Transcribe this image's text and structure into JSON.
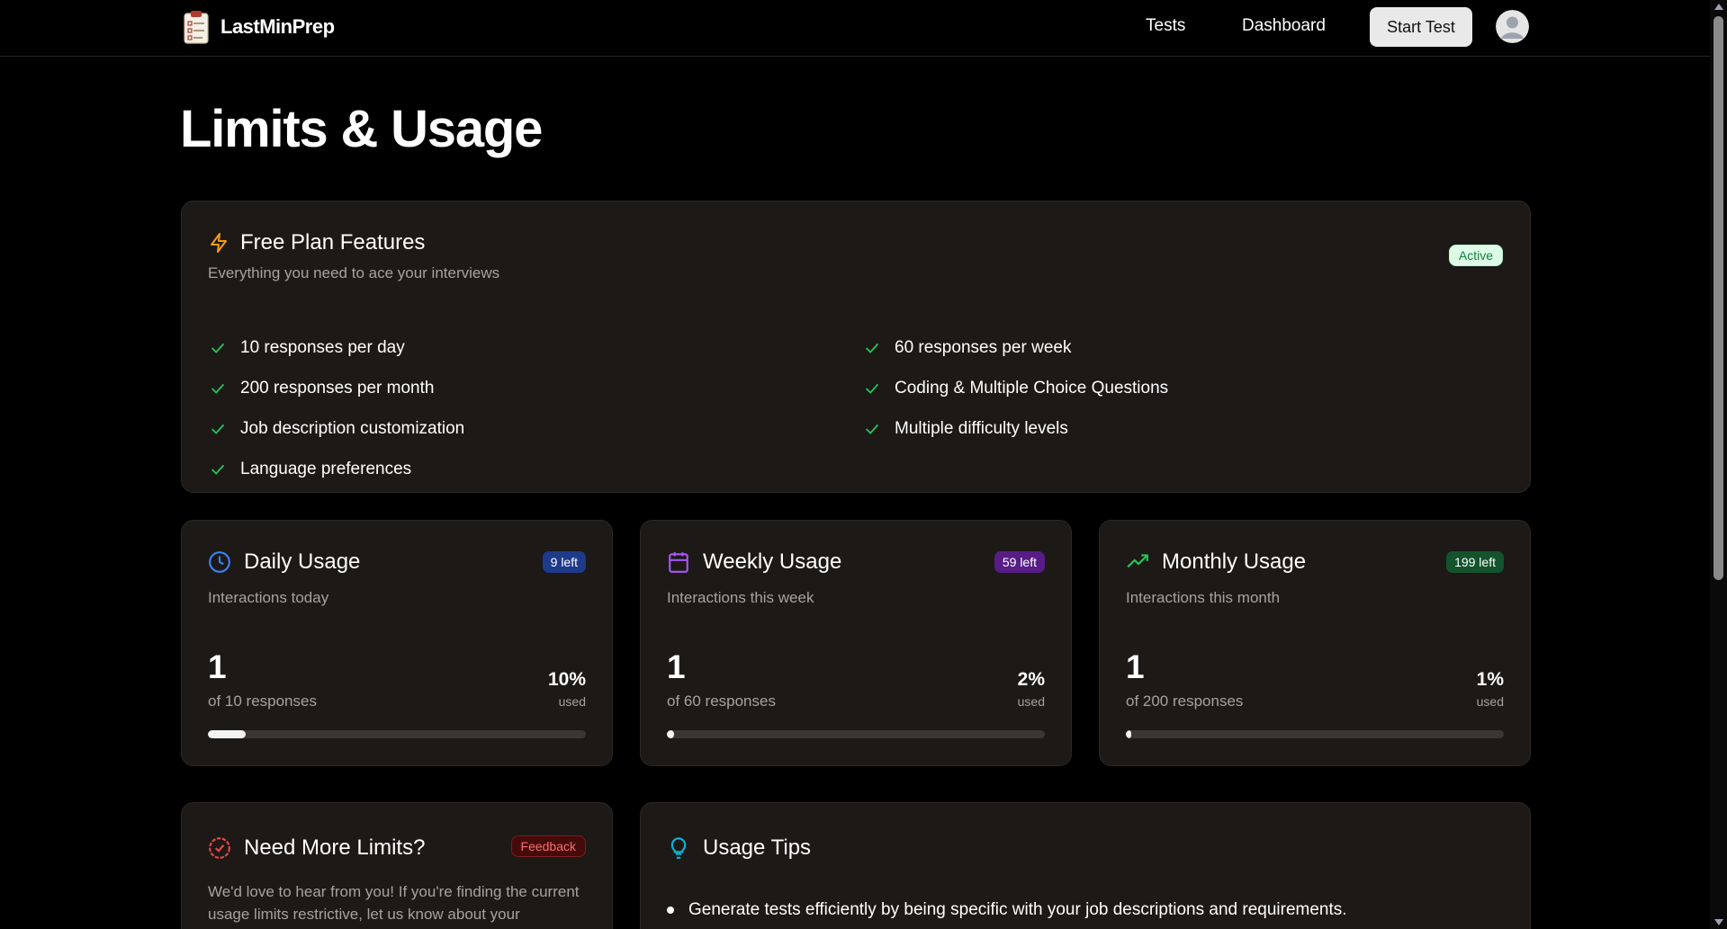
{
  "nav": {
    "brand": "LastMinPrep",
    "links": [
      "Tests",
      "Dashboard"
    ],
    "start_button": "Start Test",
    "avatar_icon": "user-avatar-icon"
  },
  "page": {
    "title": "Limits & Usage"
  },
  "plan": {
    "icon": "lightning-icon",
    "title": "Free Plan Features",
    "subtitle": "Everything you need to ace your interviews",
    "badge": "Active",
    "features_left": [
      "10 responses per day",
      "200 responses per month",
      "Job description customization",
      "Language preferences"
    ],
    "features_right": [
      "60 responses per week",
      "Coding & Multiple Choice Questions",
      "Multiple difficulty levels"
    ]
  },
  "usage": [
    {
      "icon": "clock-icon",
      "title": "Daily Usage",
      "subtitle": "Interactions today",
      "badge": "9 left",
      "badge_color": "#1e3a8a",
      "count": "1",
      "of_text": "of 10 responses",
      "percent": "10%",
      "used_label": "used",
      "fraction": 0.1
    },
    {
      "icon": "calendar-icon",
      "title": "Weekly Usage",
      "subtitle": "Interactions this week",
      "badge": "59 left",
      "badge_color": "#581c87",
      "count": "1",
      "of_text": "of 60 responses",
      "percent": "2%",
      "used_label": "used",
      "fraction": 0.02
    },
    {
      "icon": "trending-up-icon",
      "title": "Monthly Usage",
      "subtitle": "Interactions this month",
      "badge": "199 left",
      "badge_color": "#14532d",
      "count": "1",
      "of_text": "of 200 responses",
      "percent": "1%",
      "used_label": "used",
      "fraction": 0.01
    }
  ],
  "more": {
    "icon": "badge-check-icon",
    "title": "Need More Limits?",
    "badge": "Feedback",
    "text": "We'd love to hear from you! If you're finding the current usage limits restrictive, let us know about your"
  },
  "tips": {
    "icon": "lightbulb-icon",
    "title": "Usage Tips",
    "items": [
      "Generate tests efficiently by being specific with your job descriptions and requirements."
    ]
  },
  "colors": {
    "accent_green": "#22c55e",
    "accent_orange": "#f59e0b",
    "card_bg": "#1c1917"
  }
}
